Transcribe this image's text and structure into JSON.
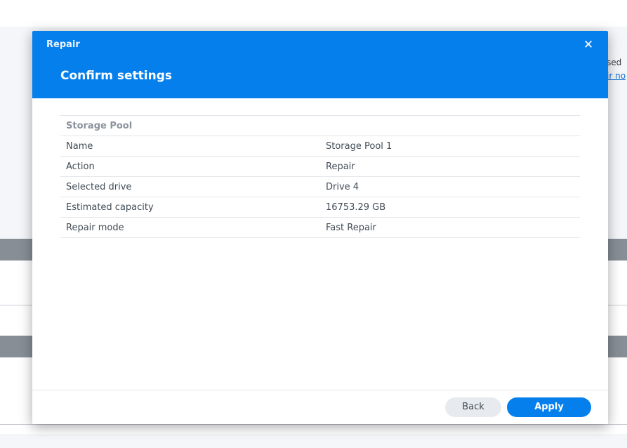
{
  "background": {
    "text_fragment": "sed",
    "link_fragment": "ir no"
  },
  "dialog": {
    "window_title": "Repair",
    "close_icon": "close-icon",
    "step_title": "Confirm settings",
    "section_title": "Storage Pool",
    "rows": [
      {
        "key": "Name",
        "value": "Storage Pool 1"
      },
      {
        "key": "Action",
        "value": "Repair"
      },
      {
        "key": "Selected drive",
        "value": "Drive 4"
      },
      {
        "key": "Estimated capacity",
        "value": "16753.29 GB"
      },
      {
        "key": "Repair mode",
        "value": "Fast Repair"
      }
    ],
    "buttons": {
      "back": "Back",
      "apply": "Apply"
    }
  },
  "colors": {
    "header": "#057feb",
    "primary_button": "#057feb",
    "secondary_button": "#e7ebf0"
  }
}
